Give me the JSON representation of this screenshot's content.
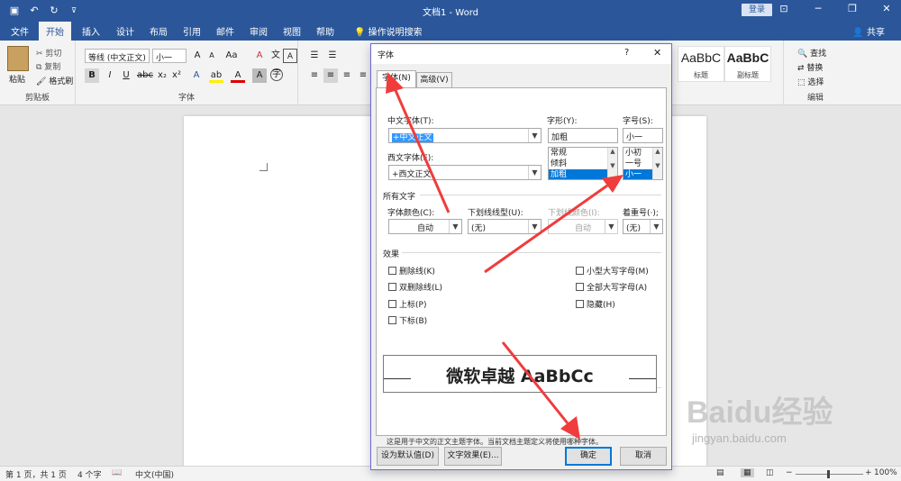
{
  "app": {
    "title": "文档1 - Word",
    "login": "登录",
    "share": "共享",
    "tell_me": "操作说明搜索"
  },
  "menu_tabs": [
    "文件",
    "开始",
    "插入",
    "设计",
    "布局",
    "引用",
    "邮件",
    "审阅",
    "视图",
    "帮助"
  ],
  "active_tab": "开始",
  "ribbon": {
    "clipboard": {
      "paste": "粘贴",
      "cut": "剪切",
      "copy": "复制",
      "format_painter": "格式刷",
      "group": "剪贴板"
    },
    "font": {
      "font_name": "等线 (中文正文)",
      "font_size": "小一",
      "group": "字体"
    },
    "styles": [
      {
        "sample": "AaBbC",
        "name": "标题"
      },
      {
        "sample": "AaBbC",
        "name": "副标题"
      }
    ],
    "editing": {
      "find": "查找",
      "replace": "替换",
      "select": "选择",
      "group": "编辑"
    }
  },
  "dialog": {
    "title": "字体",
    "help": "?",
    "tabs": [
      "字体(N)",
      "高级(V)"
    ],
    "chinese_font_label": "中文字体(T):",
    "chinese_font_value": "+中文正文",
    "western_font_label": "西文字体(F):",
    "western_font_value": "+西文正文",
    "style_label": "字形(Y):",
    "style_value": "加粗",
    "style_options": [
      "常规",
      "倾斜",
      "加粗"
    ],
    "size_label": "字号(S):",
    "size_value": "小一",
    "size_options": [
      "小初",
      "一号",
      "小一"
    ],
    "all_text_section": "所有文字",
    "font_color_label": "字体颜色(C):",
    "font_color_value": "自动",
    "underline_label": "下划线线型(U):",
    "underline_value": "(无)",
    "underline_color_label": "下划线颜色(I):",
    "underline_color_value": "自动",
    "emphasis_label": "着重号(·);",
    "emphasis_value": "(无)",
    "effects_section": "效果",
    "effects_left": [
      "删除线(K)",
      "双删除线(L)",
      "上标(P)",
      "下标(B)"
    ],
    "effects_right": [
      "小型大写字母(M)",
      "全部大写字母(A)",
      "隐藏(H)"
    ],
    "preview_section": "预览",
    "preview_text": "微软卓越  AaBbCc",
    "preview_note": "这是用于中文的正文主题字体。当前文档主题定义将使用哪种字体。",
    "set_default": "设为默认值(D)",
    "text_effects": "文字效果(E)...",
    "ok": "确定",
    "cancel": "取消"
  },
  "status": {
    "page": "第 1 页，共 1 页",
    "words": "4 个字",
    "language": "中文(中国)",
    "zoom": "100%"
  },
  "watermark": {
    "brand": "Baidu经验",
    "url": "jingyan.baidu.com"
  },
  "colors": {
    "word_blue": "#2b579a",
    "arrow_red": "#f03c3c",
    "dialog_border": "#6b6bd6"
  }
}
